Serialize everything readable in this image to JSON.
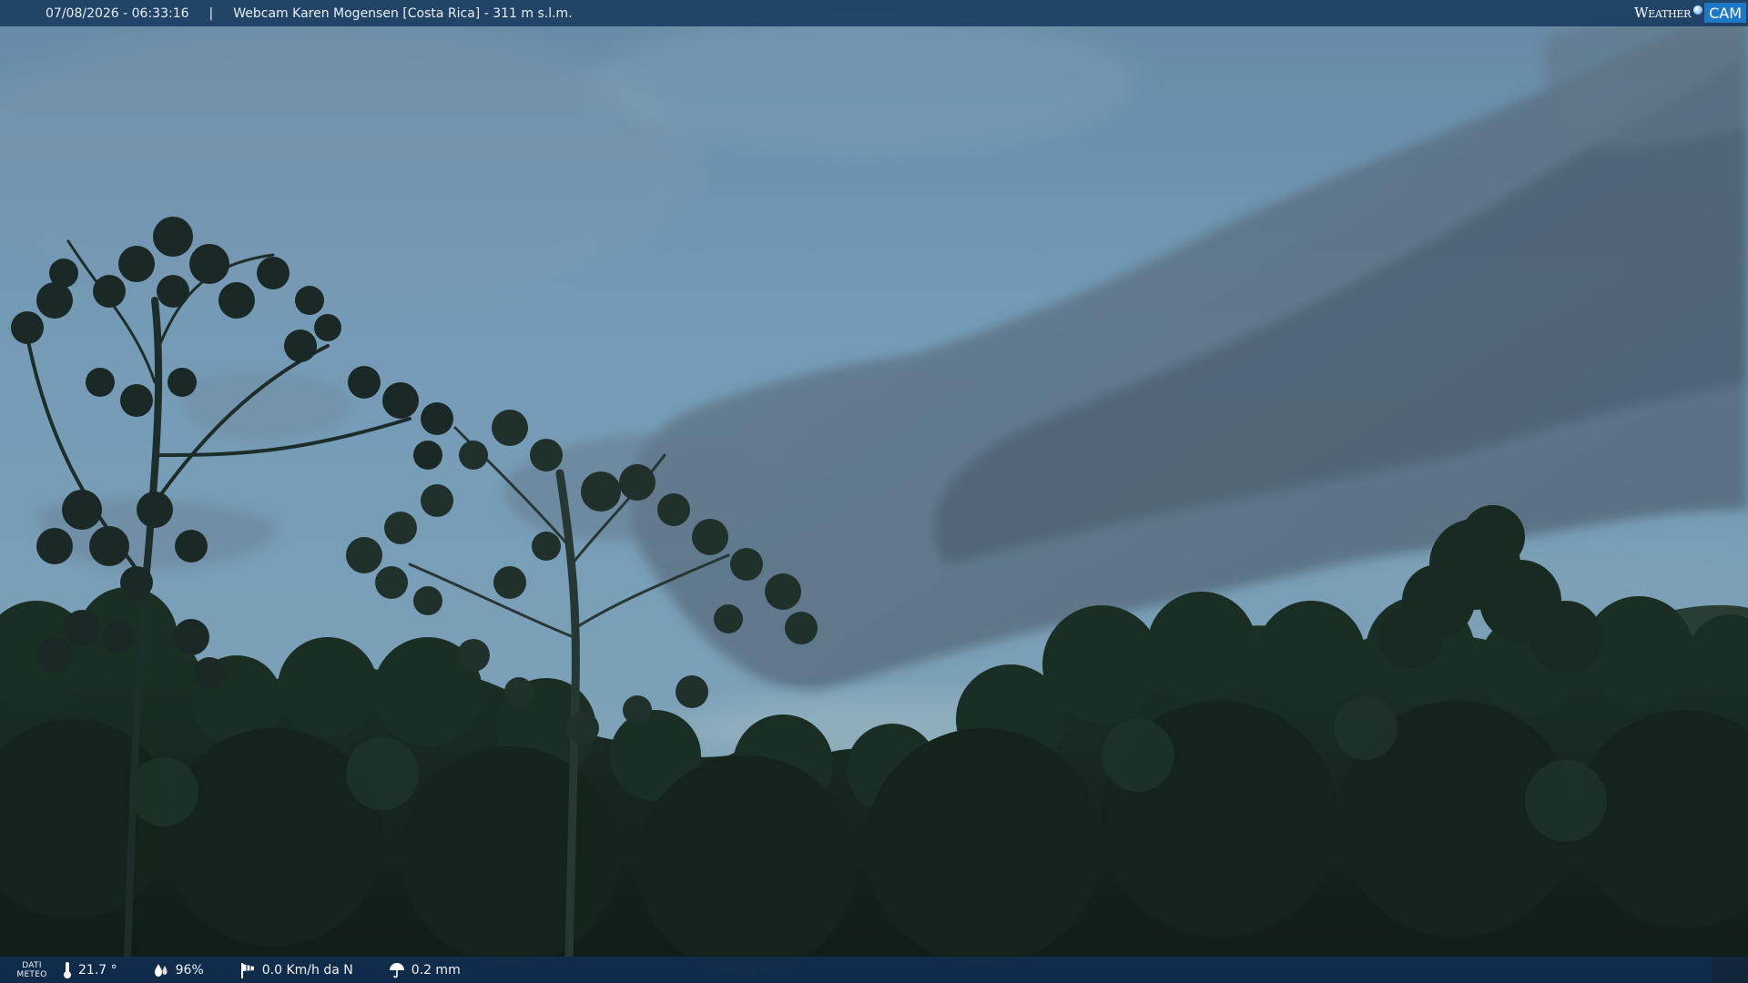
{
  "header": {
    "datetime": "07/08/2026 - 06:33:16",
    "separator": "|",
    "title": "Webcam Karen Mogensen [Costa Rica] - 311 m s.l.m."
  },
  "logo": {
    "text_weather": "Weather",
    "text_cam": "CAM"
  },
  "footer": {
    "dati_line1": "DATI",
    "dati_line2": "METEO",
    "temperature": "21.7 °",
    "humidity": "96%",
    "wind": "0.0 Km/h da N",
    "rain": "0.2 mm"
  },
  "icons": {
    "temperature": "thermometer-icon",
    "humidity": "drops-icon",
    "wind": "windsock-icon",
    "rain": "umbrella-icon"
  },
  "colors": {
    "bar": "#183a60",
    "cam_badge": "#1e78c8"
  }
}
